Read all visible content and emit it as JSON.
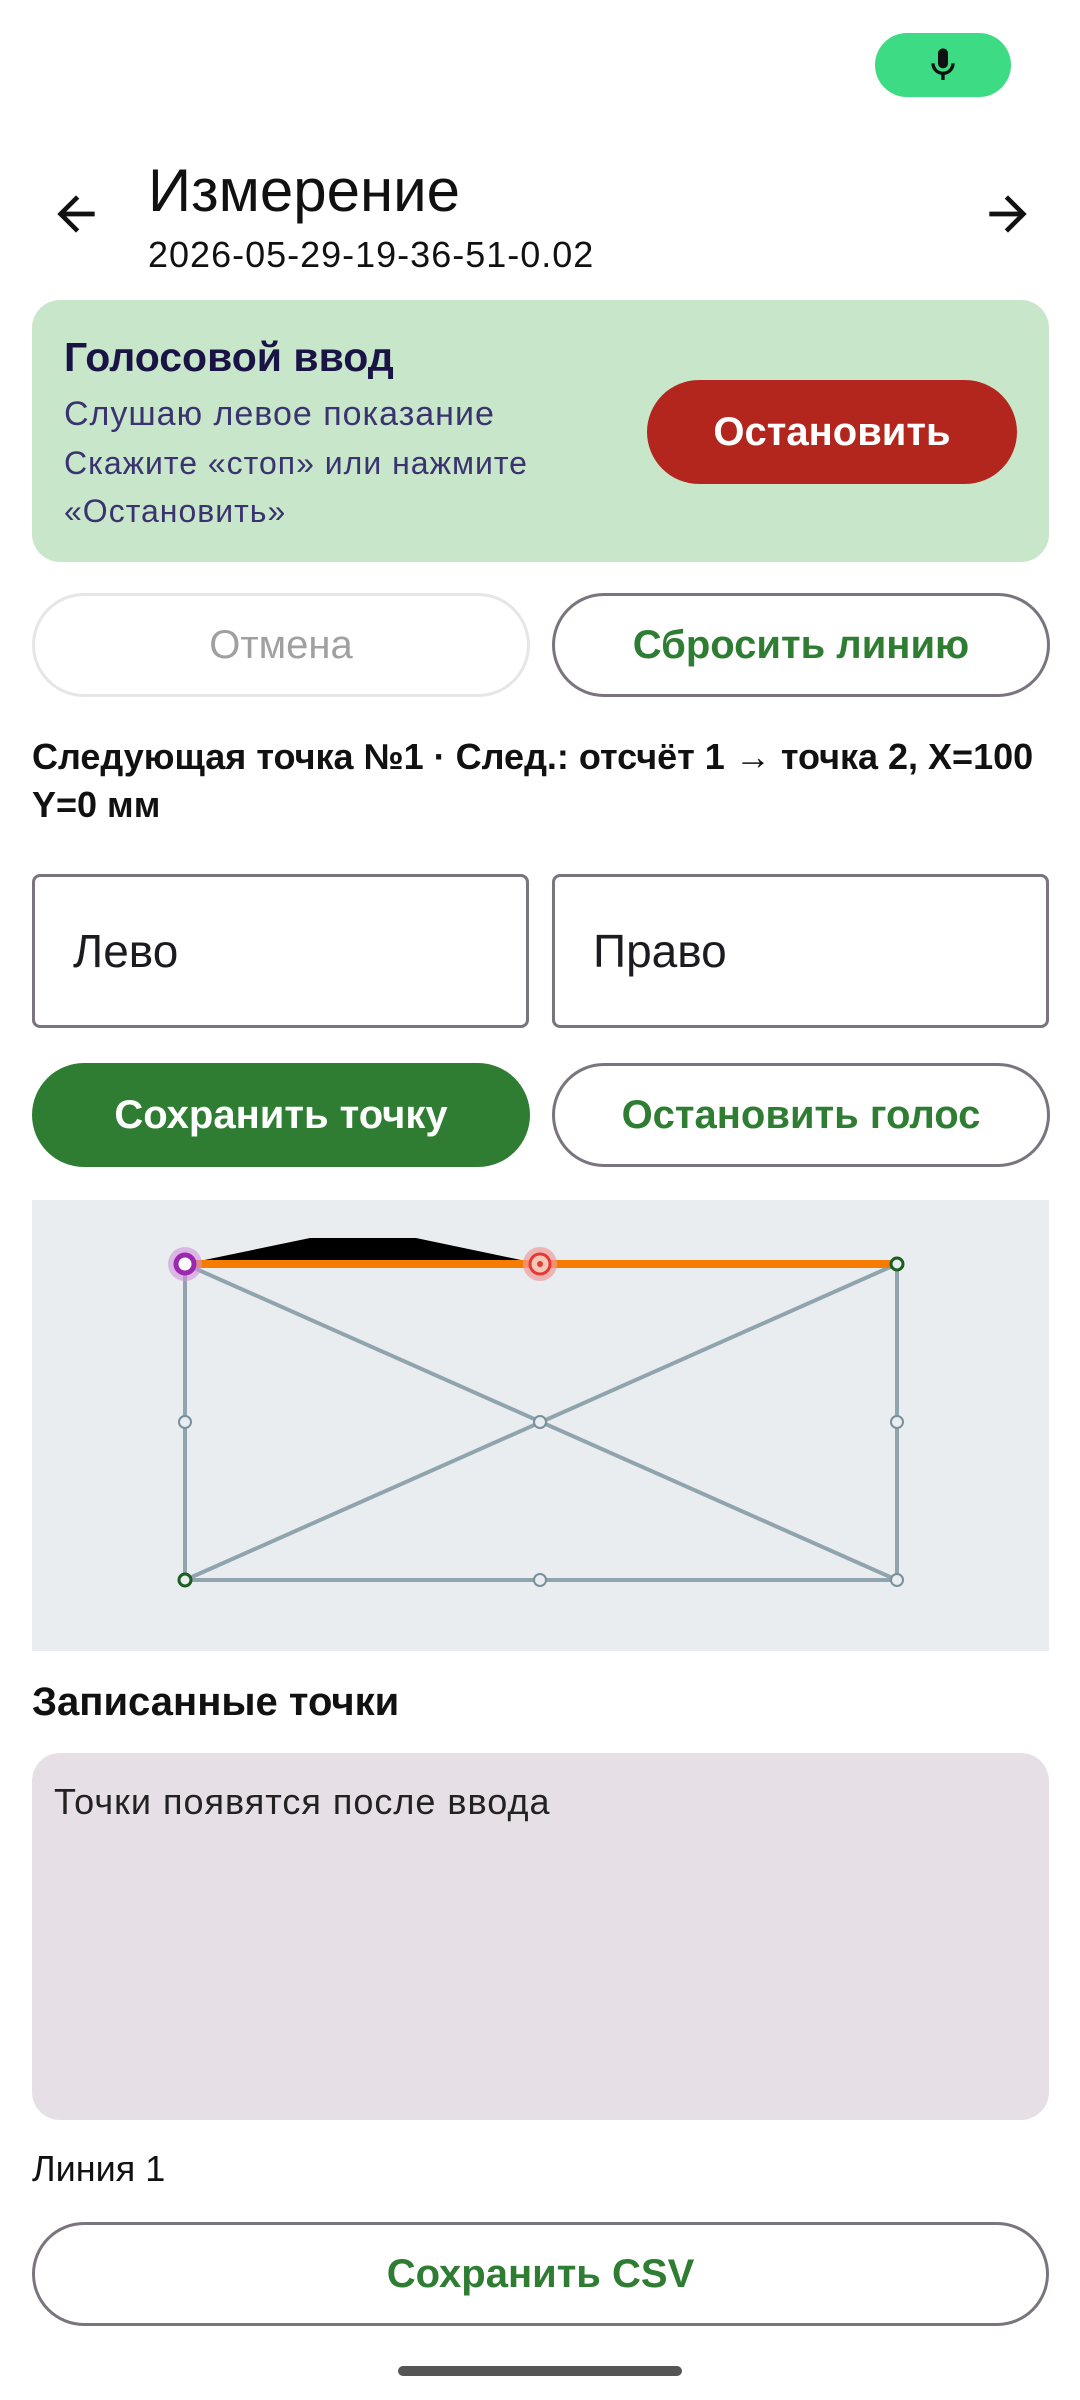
{
  "header": {
    "title": "Измерение",
    "subtitle": "2026-05-29-19-36-51-0.02",
    "back_icon": "arrow-back-icon",
    "forward_icon": "arrow-forward-icon",
    "mic_icon": "mic-icon"
  },
  "voice": {
    "title": "Голосовой ввод",
    "status": "Слушаю левое показание",
    "hint_line1": "Скажите «стоп» или нажмите",
    "hint_line2": "«Остановить»",
    "stop_label": "Остановить"
  },
  "actions": {
    "cancel_label": "Отмена",
    "reset_line_label": "Сбросить линию",
    "save_point_label": "Сохранить точку",
    "stop_voice_label": "Остановить голос"
  },
  "next_point_text": "Следующая точка №1 · След.: отсчёт 1 → точка 2, X=100 Y=0 мм",
  "fields": {
    "left_placeholder": "Лево",
    "right_placeholder": "Право"
  },
  "recorded": {
    "heading": "Записанные точки",
    "empty_text": "Точки появятся после ввода"
  },
  "line_label": "Линия 1",
  "save_csv_label": "Сохранить CSV",
  "colors": {
    "accent": "#2e7d32",
    "mic": "#3ddc84",
    "stop": "#b3261e",
    "voice_card": "#c8e6c9",
    "active_line": "#f57c00",
    "grid_line": "#90a4ae"
  }
}
